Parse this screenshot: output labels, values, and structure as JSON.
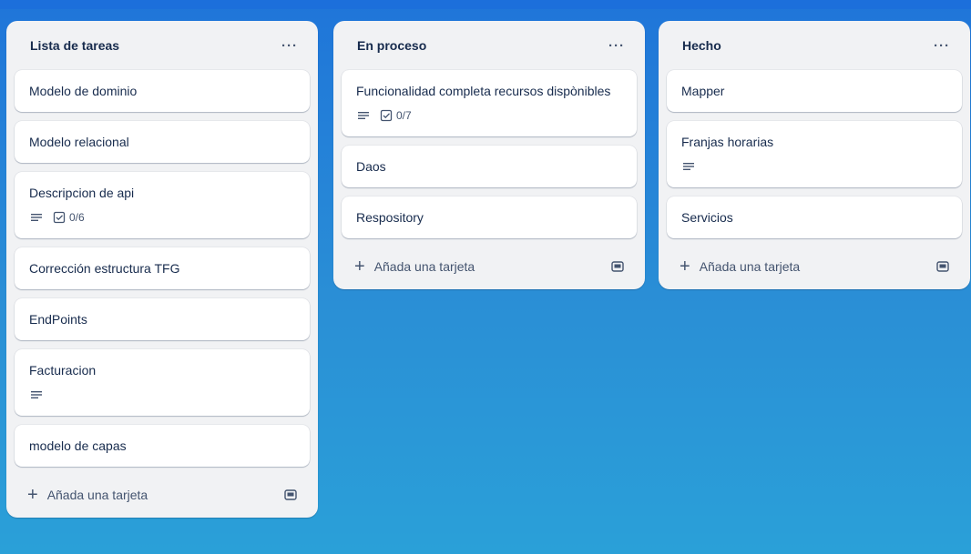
{
  "board": {
    "lists": [
      {
        "title": "Lista de tareas",
        "menu": "···",
        "cards": [
          {
            "title": "Modelo de dominio"
          },
          {
            "title": "Modelo relacional"
          },
          {
            "title": "Descripcion de api",
            "checklist": "0/6"
          },
          {
            "title": "Corrección estructura TFG"
          },
          {
            "title": "EndPoints"
          },
          {
            "title": "Facturacion"
          },
          {
            "title": "modelo de capas"
          }
        ],
        "add_label": "Añada una tarjeta"
      },
      {
        "title": "En proceso",
        "menu": "···",
        "cards": [
          {
            "title": "Funcionalidad completa recursos dispònibles",
            "checklist": "0/7"
          },
          {
            "title": "Daos"
          },
          {
            "title": "Respository"
          }
        ],
        "add_label": "Añada una tarjeta"
      },
      {
        "title": "Hecho",
        "menu": "···",
        "cards": [
          {
            "title": "Mapper"
          },
          {
            "title": "Franjas horarias"
          },
          {
            "title": "Servicios"
          }
        ],
        "add_label": "Añada una tarjeta"
      }
    ]
  },
  "icons": {
    "plus": "+",
    "description": "description-icon",
    "checklist": "checklist-icon",
    "template": "template-icon"
  },
  "colors": {
    "board_top": "#1f75d9",
    "board_bottom": "#2aa0d8",
    "list_bg": "#f1f2f4",
    "card_bg": "#ffffff",
    "text": "#172b4d",
    "muted": "#44546f"
  }
}
